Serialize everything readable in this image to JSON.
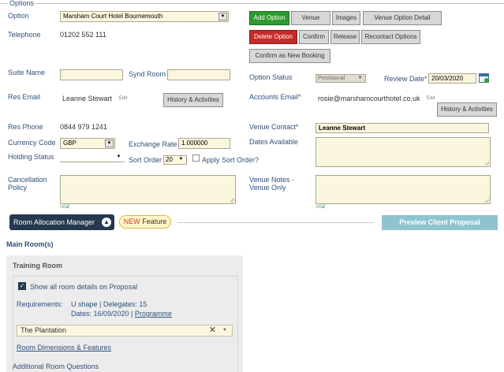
{
  "legend": "Options",
  "labels": {
    "option": "Option",
    "telephone": "Telephone",
    "suite_name": "Suite Name",
    "synd_room": "Synd Room",
    "res_email": "Res Email",
    "res_phone": "Res Phone",
    "currency_code": "Currency Code",
    "exchange_rate": "Exchange Rate",
    "holding_status": "Holding Status",
    "sort_order": "Sort Order",
    "apply_sort_order": "Apply Sort Order?",
    "cancellation_policy_1": "Cancellation",
    "cancellation_policy_2": "Policy",
    "option_status": "Option Status",
    "review_date": "Review Date*",
    "accounts_email": "Accounts Email*",
    "venue_contact": "Venue Contact*",
    "dates_available": "Dates Available",
    "venue_notes_1": "Venue Notes -",
    "venue_notes_2": "Venue Only"
  },
  "values": {
    "option": "Marsham Court Hotel Bournemouth",
    "telephone": "01202 552 111",
    "suite_name": "",
    "synd_room": "",
    "res_email": "Leanne Stewart",
    "res_phone": "0844 979 1241",
    "currency_code": "GBP",
    "exchange_rate": "1.000000",
    "holding_status": "",
    "sort_order": "20",
    "option_status": "Provisional",
    "review_date": "20/03/2020",
    "accounts_email": "rosie@marshamcourthotel.co.uk",
    "venue_contact": "Leanne Stewart",
    "edit": "Edit",
    "spell": "ABC"
  },
  "buttons": {
    "add_option": "Add Option",
    "venue": "Venue",
    "images": "Images",
    "venue_option_detail": "Venue Option Detail",
    "delete_option": "Delete Option",
    "confirm": "Confirm",
    "release": "Release",
    "recontact_options": "Recontact Options",
    "confirm_new_booking": "Confirm as New Booking",
    "history_activities": "History & Activities",
    "history_activities_2": "History & Activities",
    "room_allocation_manager": "Room Allocation Manager",
    "new_badge_new": "NEW",
    "new_badge_feature": " Feature",
    "preview_proposal": "Preview Client Proposal Document"
  },
  "rooms": {
    "section_title": "Main Room(s)",
    "room_name": "Training Room",
    "show_details": "Show all room details on Proposal",
    "requirements_label": "Requirements:",
    "requirements_value": "U shape | Delegates: 15",
    "dates_prefix": "Dates: 16/09/2020 | ",
    "programme_link": "Programme",
    "selected_room": "The Plantation",
    "dimensions_link": "Room Dimensions & Features",
    "additional_questions": "Additional Room Questions"
  },
  "colors": {
    "accent_green": "#2e9b2e",
    "accent_red": "#c62a2a",
    "ram_dark": "#24384f",
    "preview_teal": "#8fc4cf",
    "field_bg": "#fbf6de"
  }
}
